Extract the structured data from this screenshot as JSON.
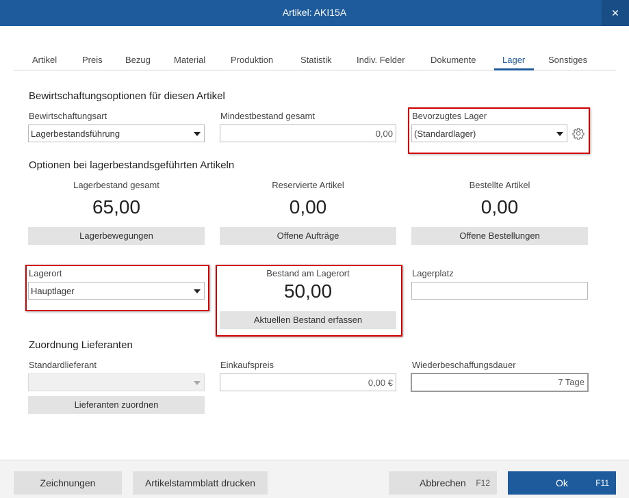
{
  "window": {
    "title": "Artikel: AKI15A",
    "close_label": "✕"
  },
  "tabs": [
    {
      "label": "Artikel"
    },
    {
      "label": "Preis"
    },
    {
      "label": "Bezug"
    },
    {
      "label": "Material"
    },
    {
      "label": "Produktion"
    },
    {
      "label": "Statistik"
    },
    {
      "label": "Indiv. Felder"
    },
    {
      "label": "Dokumente"
    },
    {
      "label": "Lager",
      "active": true
    },
    {
      "label": "Sonstiges"
    }
  ],
  "bewirtschaftung": {
    "heading": "Bewirtschaftungsoptionen für diesen Artikel",
    "art_label": "Bewirtschaftungsart",
    "art_value": "Lagerbestandsführung",
    "mindest_label": "Mindestbestand gesamt",
    "mindest_value": "0,00",
    "lager_label": "Bevorzugtes Lager",
    "lager_value": "(Standardlager)",
    "settings_icon": "gear-icon"
  },
  "optionen": {
    "heading": "Optionen bei lagerbestandsgeführten Artikeln",
    "lagerbestand_label": "Lagerbestand gesamt",
    "lagerbestand_value": "65,00",
    "lagerbestand_button": "Lagerbewegungen",
    "reserviert_label": "Reservierte Artikel",
    "reserviert_value": "0,00",
    "reserviert_button": "Offene Aufträge",
    "bestellt_label": "Bestellte Artikel",
    "bestellt_value": "0,00",
    "bestellt_button": "Offene Bestellungen"
  },
  "lagerort": {
    "label": "Lagerort",
    "value": "Hauptlager",
    "bestand_label": "Bestand am Lagerort",
    "bestand_value": "50,00",
    "bestand_button": "Aktuellen Bestand erfassen",
    "platz_label": "Lagerplatz",
    "platz_value": ""
  },
  "lieferanten": {
    "heading": "Zuordnung Lieferanten",
    "standard_label": "Standardlieferant",
    "standard_value": "",
    "zuordnen_button": "Lieferanten zuordnen",
    "preis_label": "Einkaufspreis",
    "preis_value": "0,00 €",
    "dauer_label": "Wiederbeschaffungsdauer",
    "dauer_value": "7 Tage"
  },
  "footer": {
    "zeichnungen": "Zeichnungen",
    "stammblatt": "Artikelstammblatt drucken",
    "abbrechen": "Abbrechen",
    "abbrechen_key": "F12",
    "ok": "Ok",
    "ok_key": "F11"
  },
  "colors": {
    "accent": "#1e5b9c",
    "highlight": "#d20000",
    "button_bg": "#e3e3e3"
  }
}
